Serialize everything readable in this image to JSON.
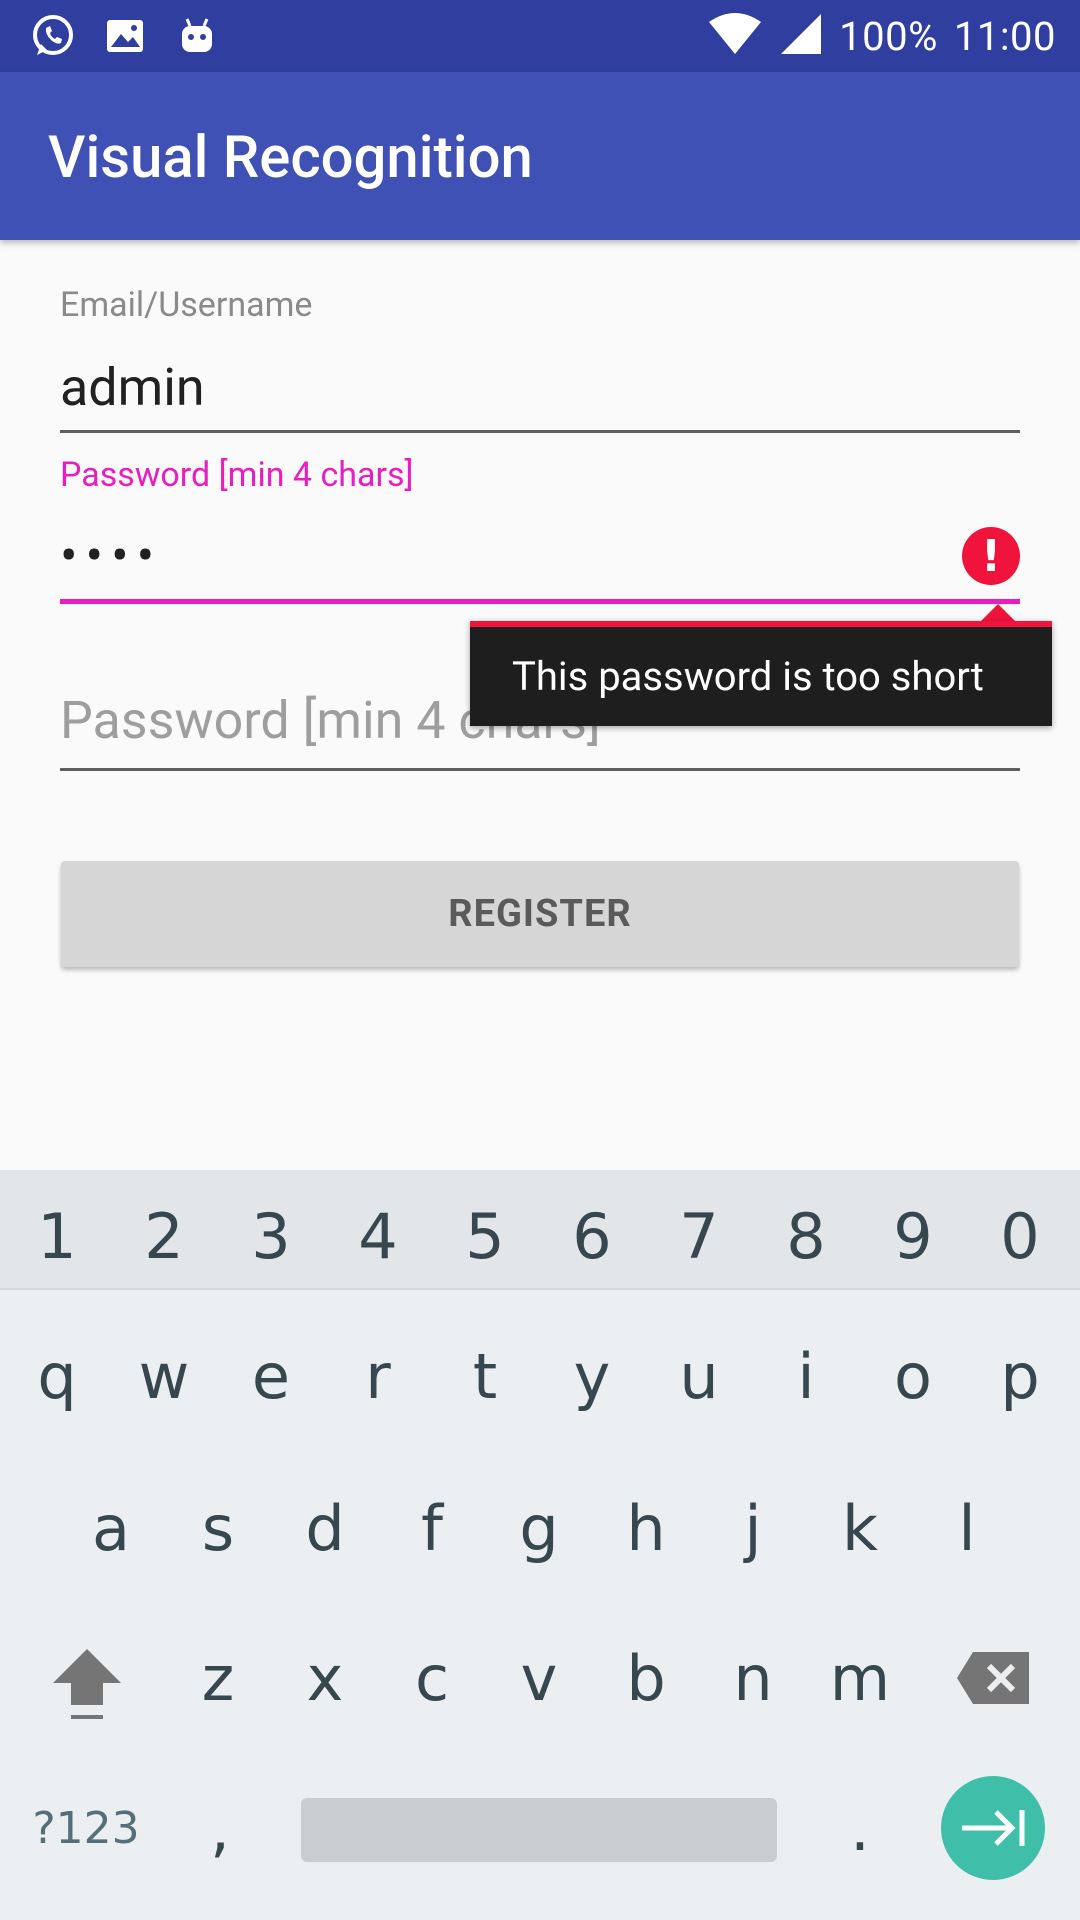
{
  "status_bar": {
    "icons": [
      "whatsapp-icon",
      "image-icon",
      "android-icon",
      "wifi-icon",
      "signal-icon"
    ],
    "battery": "100%",
    "time": "11:00"
  },
  "app_bar": {
    "title": "Visual Recognition"
  },
  "form": {
    "email_label": "Email/Username",
    "email_value": "admin",
    "password_label": "Password [min 4 chars]",
    "password_value": "••••",
    "error_tooltip": "This password is too short",
    "confirm_placeholder": "Password [min 4 chars]",
    "register_label": "REGISTER"
  },
  "keyboard": {
    "number_row": [
      "1",
      "2",
      "3",
      "4",
      "5",
      "6",
      "7",
      "8",
      "9",
      "0"
    ],
    "row1": [
      "q",
      "w",
      "e",
      "r",
      "t",
      "y",
      "u",
      "i",
      "o",
      "p"
    ],
    "row2": [
      "a",
      "s",
      "d",
      "f",
      "g",
      "h",
      "j",
      "k",
      "l"
    ],
    "row3": [
      "z",
      "x",
      "c",
      "v",
      "b",
      "n",
      "m"
    ],
    "symbols_key": "?123",
    "comma_key": ",",
    "period_key": "."
  },
  "colors": {
    "status_bar": "#303f9f",
    "app_bar": "#3f51b5",
    "accent": "#e91ec1",
    "error": "#f0143c",
    "enter_key": "#3fbfa9"
  }
}
